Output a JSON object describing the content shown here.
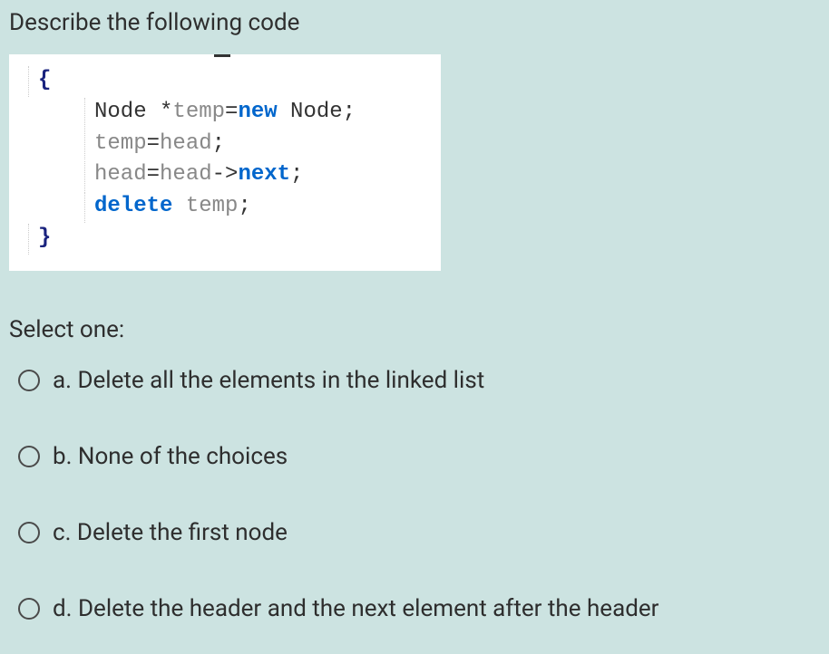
{
  "question": {
    "prompt": "Describe the following code",
    "select_label": "Select one:"
  },
  "code": {
    "line1_brace_open": "{",
    "line2_type": "Node ",
    "line2_star": "*",
    "line2_var": "temp",
    "line2_eq": "=",
    "line2_new": "new",
    "line2_type2": " Node",
    "line2_semi": ";",
    "line3_var": "temp",
    "line3_eq": "=",
    "line3_head": "head",
    "line3_semi": ";",
    "line4_head": "head",
    "line4_eq": "=",
    "line4_head2": "head",
    "line4_arrow": "->",
    "line4_next": "next",
    "line4_semi": ";",
    "line5_delete": "delete",
    "line5_sp": " ",
    "line5_var": "temp",
    "line5_semi": ";",
    "line6_brace_close": "}"
  },
  "options": [
    {
      "label": "a. Delete all the elements in the linked list"
    },
    {
      "label": "b. None of the choices"
    },
    {
      "label": "c. Delete the first node"
    },
    {
      "label": "d. Delete the header and the next element after the header"
    }
  ]
}
